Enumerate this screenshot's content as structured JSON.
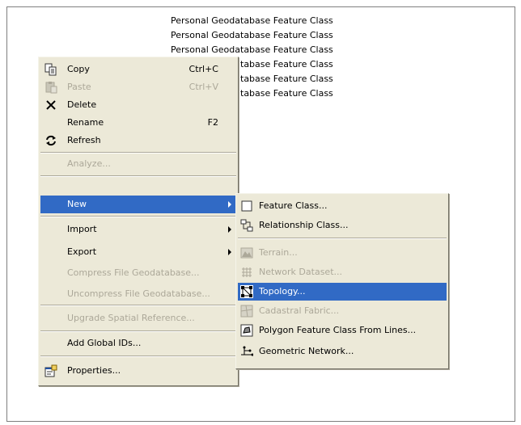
{
  "list_rows": [
    "Personal Geodatabase Feature Class",
    "Personal Geodatabase Feature Class",
    "Personal Geodatabase Feature Class",
    "Personal Geodatabase Feature Class",
    "Personal Geodatabase Feature Class",
    "Personal Geodatabase Feature Class"
  ],
  "context_menu": {
    "copy": {
      "label": "Copy",
      "shortcut": "Ctrl+C"
    },
    "paste": {
      "label": "Paste",
      "shortcut": "Ctrl+V"
    },
    "delete": {
      "label": "Delete"
    },
    "rename": {
      "label": "Rename",
      "shortcut": "F2"
    },
    "refresh": {
      "label": "Refresh"
    },
    "analyze": {
      "label": "Analyze..."
    },
    "new": {
      "label": "New"
    },
    "import": {
      "label": "Import"
    },
    "export": {
      "label": "Export"
    },
    "compress": {
      "label": "Compress File Geodatabase..."
    },
    "uncompress": {
      "label": "Uncompress File Geodatabase..."
    },
    "upgrade": {
      "label": "Upgrade Spatial Reference..."
    },
    "add_global_ids": {
      "label": "Add Global IDs..."
    },
    "properties": {
      "label": "Properties..."
    }
  },
  "submenu": {
    "feature_class": {
      "label": "Feature Class..."
    },
    "relationship_class": {
      "label": "Relationship Class..."
    },
    "terrain": {
      "label": "Terrain..."
    },
    "network_dataset": {
      "label": "Network Dataset..."
    },
    "topology": {
      "label": "Topology..."
    },
    "cadastral_fabric": {
      "label": "Cadastral Fabric..."
    },
    "polygon_from_lines": {
      "label": "Polygon Feature Class From Lines..."
    },
    "geometric_network": {
      "label": "Geometric Network..."
    }
  },
  "colors": {
    "highlight": "#316ac5",
    "menu_bg": "#ece9d8",
    "disabled": "#aca899"
  }
}
